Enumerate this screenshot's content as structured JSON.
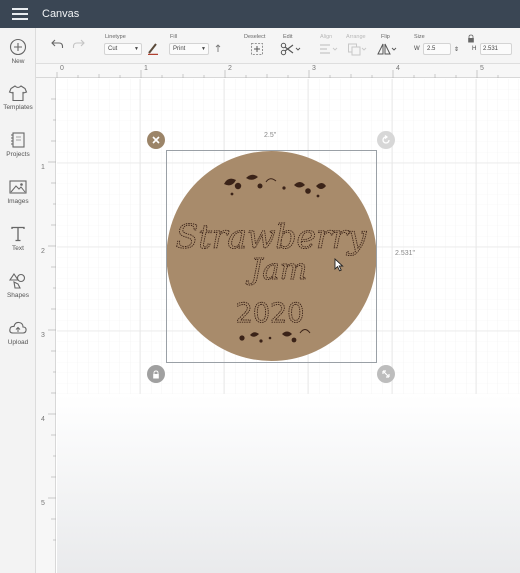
{
  "app": {
    "title": "Canvas"
  },
  "sidebar": {
    "items": [
      {
        "label": "New",
        "icon": "plus-icon"
      },
      {
        "label": "Templates",
        "icon": "tshirt-icon"
      },
      {
        "label": "Projects",
        "icon": "projects-icon"
      },
      {
        "label": "Images",
        "icon": "image-icon"
      },
      {
        "label": "Text",
        "icon": "text-icon"
      },
      {
        "label": "Shapes",
        "icon": "shapes-icon"
      },
      {
        "label": "Upload",
        "icon": "upload-icon"
      }
    ]
  },
  "toolbar": {
    "linetype_label": "Linetype",
    "linetype_value": "Cut",
    "fill_label": "Fill",
    "fill_value": "Print",
    "deselect_label": "Deselect",
    "edit_label": "Edit",
    "align_label": "Align",
    "arrange_label": "Arrange",
    "flip_label": "Flip",
    "size_label": "Size",
    "width_prefix": "W",
    "width_value": "2.5",
    "height_prefix": "H",
    "height_value": "2.531"
  },
  "rulers": {
    "top": [
      "0",
      "1",
      "2",
      "3",
      "4",
      "5"
    ],
    "left": [
      "1",
      "2",
      "3",
      "4",
      "5"
    ]
  },
  "design": {
    "line1": "Strawberry",
    "line2": "Jam",
    "line3": "2020",
    "circle_color": "#a88b6b",
    "ink_color": "#3b2318"
  },
  "selection": {
    "width_label": "2.5\"",
    "height_label": "2.531\""
  }
}
